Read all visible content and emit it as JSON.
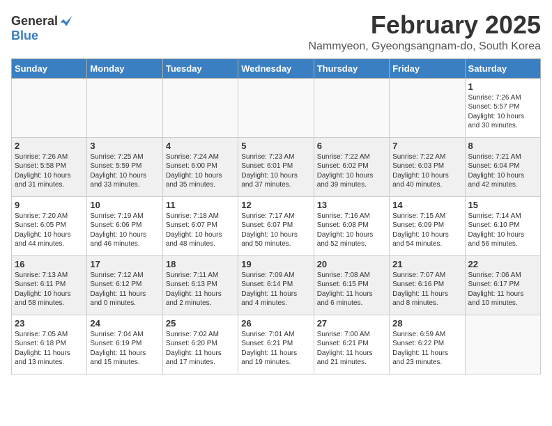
{
  "header": {
    "logo_general": "General",
    "logo_blue": "Blue",
    "title": "February 2025",
    "subtitle": "Nammyeon, Gyeongsangnam-do, South Korea"
  },
  "days_of_week": [
    "Sunday",
    "Monday",
    "Tuesday",
    "Wednesday",
    "Thursday",
    "Friday",
    "Saturday"
  ],
  "weeks": [
    {
      "shaded": false,
      "days": [
        {
          "num": "",
          "info": ""
        },
        {
          "num": "",
          "info": ""
        },
        {
          "num": "",
          "info": ""
        },
        {
          "num": "",
          "info": ""
        },
        {
          "num": "",
          "info": ""
        },
        {
          "num": "",
          "info": ""
        },
        {
          "num": "1",
          "info": "Sunrise: 7:26 AM\nSunset: 5:57 PM\nDaylight: 10 hours\nand 30 minutes."
        }
      ]
    },
    {
      "shaded": true,
      "days": [
        {
          "num": "2",
          "info": "Sunrise: 7:26 AM\nSunset: 5:58 PM\nDaylight: 10 hours\nand 31 minutes."
        },
        {
          "num": "3",
          "info": "Sunrise: 7:25 AM\nSunset: 5:59 PM\nDaylight: 10 hours\nand 33 minutes."
        },
        {
          "num": "4",
          "info": "Sunrise: 7:24 AM\nSunset: 6:00 PM\nDaylight: 10 hours\nand 35 minutes."
        },
        {
          "num": "5",
          "info": "Sunrise: 7:23 AM\nSunset: 6:01 PM\nDaylight: 10 hours\nand 37 minutes."
        },
        {
          "num": "6",
          "info": "Sunrise: 7:22 AM\nSunset: 6:02 PM\nDaylight: 10 hours\nand 39 minutes."
        },
        {
          "num": "7",
          "info": "Sunrise: 7:22 AM\nSunset: 6:03 PM\nDaylight: 10 hours\nand 40 minutes."
        },
        {
          "num": "8",
          "info": "Sunrise: 7:21 AM\nSunset: 6:04 PM\nDaylight: 10 hours\nand 42 minutes."
        }
      ]
    },
    {
      "shaded": false,
      "days": [
        {
          "num": "9",
          "info": "Sunrise: 7:20 AM\nSunset: 6:05 PM\nDaylight: 10 hours\nand 44 minutes."
        },
        {
          "num": "10",
          "info": "Sunrise: 7:19 AM\nSunset: 6:06 PM\nDaylight: 10 hours\nand 46 minutes."
        },
        {
          "num": "11",
          "info": "Sunrise: 7:18 AM\nSunset: 6:07 PM\nDaylight: 10 hours\nand 48 minutes."
        },
        {
          "num": "12",
          "info": "Sunrise: 7:17 AM\nSunset: 6:07 PM\nDaylight: 10 hours\nand 50 minutes."
        },
        {
          "num": "13",
          "info": "Sunrise: 7:16 AM\nSunset: 6:08 PM\nDaylight: 10 hours\nand 52 minutes."
        },
        {
          "num": "14",
          "info": "Sunrise: 7:15 AM\nSunset: 6:09 PM\nDaylight: 10 hours\nand 54 minutes."
        },
        {
          "num": "15",
          "info": "Sunrise: 7:14 AM\nSunset: 6:10 PM\nDaylight: 10 hours\nand 56 minutes."
        }
      ]
    },
    {
      "shaded": true,
      "days": [
        {
          "num": "16",
          "info": "Sunrise: 7:13 AM\nSunset: 6:11 PM\nDaylight: 10 hours\nand 58 minutes."
        },
        {
          "num": "17",
          "info": "Sunrise: 7:12 AM\nSunset: 6:12 PM\nDaylight: 11 hours\nand 0 minutes."
        },
        {
          "num": "18",
          "info": "Sunrise: 7:11 AM\nSunset: 6:13 PM\nDaylight: 11 hours\nand 2 minutes."
        },
        {
          "num": "19",
          "info": "Sunrise: 7:09 AM\nSunset: 6:14 PM\nDaylight: 11 hours\nand 4 minutes."
        },
        {
          "num": "20",
          "info": "Sunrise: 7:08 AM\nSunset: 6:15 PM\nDaylight: 11 hours\nand 6 minutes."
        },
        {
          "num": "21",
          "info": "Sunrise: 7:07 AM\nSunset: 6:16 PM\nDaylight: 11 hours\nand 8 minutes."
        },
        {
          "num": "22",
          "info": "Sunrise: 7:06 AM\nSunset: 6:17 PM\nDaylight: 11 hours\nand 10 minutes."
        }
      ]
    },
    {
      "shaded": false,
      "days": [
        {
          "num": "23",
          "info": "Sunrise: 7:05 AM\nSunset: 6:18 PM\nDaylight: 11 hours\nand 13 minutes."
        },
        {
          "num": "24",
          "info": "Sunrise: 7:04 AM\nSunset: 6:19 PM\nDaylight: 11 hours\nand 15 minutes."
        },
        {
          "num": "25",
          "info": "Sunrise: 7:02 AM\nSunset: 6:20 PM\nDaylight: 11 hours\nand 17 minutes."
        },
        {
          "num": "26",
          "info": "Sunrise: 7:01 AM\nSunset: 6:21 PM\nDaylight: 11 hours\nand 19 minutes."
        },
        {
          "num": "27",
          "info": "Sunrise: 7:00 AM\nSunset: 6:21 PM\nDaylight: 11 hours\nand 21 minutes."
        },
        {
          "num": "28",
          "info": "Sunrise: 6:59 AM\nSunset: 6:22 PM\nDaylight: 11 hours\nand 23 minutes."
        },
        {
          "num": "",
          "info": ""
        }
      ]
    }
  ]
}
